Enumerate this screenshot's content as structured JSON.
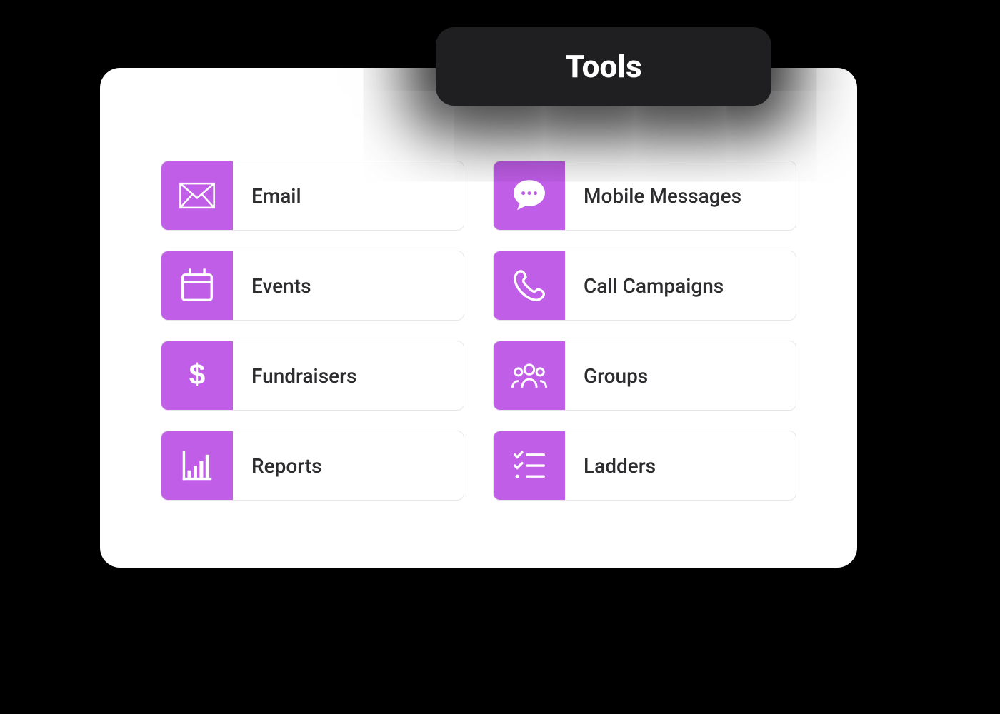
{
  "header": {
    "title": "Tools"
  },
  "tools": [
    {
      "label": "Email",
      "icon": "mail"
    },
    {
      "label": "Mobile Messages",
      "icon": "chat"
    },
    {
      "label": "Events",
      "icon": "calendar"
    },
    {
      "label": "Call Campaigns",
      "icon": "phone"
    },
    {
      "label": "Fundraisers",
      "icon": "dollar"
    },
    {
      "label": "Groups",
      "icon": "group"
    },
    {
      "label": "Reports",
      "icon": "chart"
    },
    {
      "label": "Ladders",
      "icon": "checklist"
    }
  ],
  "colors": {
    "accent": "#c15ee8",
    "pill_bg": "#1f1e21"
  }
}
